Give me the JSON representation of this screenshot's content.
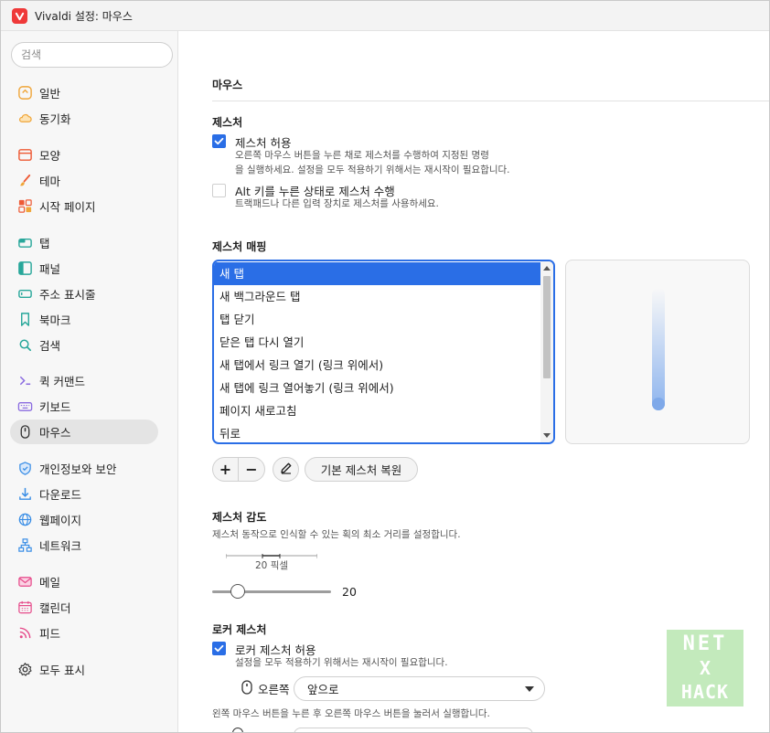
{
  "window": {
    "title": "Vivaldi 설정: 마우스"
  },
  "sidebar": {
    "search_placeholder": "검색",
    "items": [
      {
        "label": "일반",
        "icon": "general-icon",
        "color": "#f0a63a"
      },
      {
        "label": "동기화",
        "icon": "cloud-icon",
        "color": "#f0a63a"
      },
      {
        "label": "모양",
        "icon": "appearance-icon",
        "color": "#ee5a35"
      },
      {
        "label": "테마",
        "icon": "brush-icon",
        "color": "#ee5a35"
      },
      {
        "label": "시작 페이지",
        "icon": "grid-icon",
        "color": "#ee5a35"
      },
      {
        "label": "탭",
        "icon": "tab-icon",
        "color": "#28a79a"
      },
      {
        "label": "패널",
        "icon": "panel-icon",
        "color": "#28a79a"
      },
      {
        "label": "주소 표시줄",
        "icon": "address-bar-icon",
        "color": "#28a79a"
      },
      {
        "label": "북마크",
        "icon": "bookmark-icon",
        "color": "#28a79a"
      },
      {
        "label": "검색",
        "icon": "search-icon",
        "color": "#28a79a"
      },
      {
        "label": "퀵 커맨드",
        "icon": "quick-command-icon",
        "color": "#8a6be0"
      },
      {
        "label": "키보드",
        "icon": "keyboard-icon",
        "color": "#8a6be0"
      },
      {
        "label": "마우스",
        "icon": "mouse-icon",
        "color": "#333333"
      },
      {
        "label": "개인정보와 보안",
        "icon": "shield-icon",
        "color": "#3a8ee6"
      },
      {
        "label": "다운로드",
        "icon": "download-icon",
        "color": "#3a8ee6"
      },
      {
        "label": "웹페이지",
        "icon": "globe-icon",
        "color": "#3a8ee6"
      },
      {
        "label": "네트워크",
        "icon": "network-icon",
        "color": "#3a8ee6"
      },
      {
        "label": "메일",
        "icon": "mail-icon",
        "color": "#e64a8a"
      },
      {
        "label": "캘린더",
        "icon": "calendar-icon",
        "color": "#e64a8a"
      },
      {
        "label": "피드",
        "icon": "feed-icon",
        "color": "#e64a8a"
      },
      {
        "label": "모두 표시",
        "icon": "gear-icon",
        "color": "#333333"
      }
    ]
  },
  "main": {
    "page_title": "마우스",
    "gestures": {
      "title": "제스처",
      "allow_label": "제스처 허용",
      "allow_desc_1": "오른쪽 마우스 버튼을 누른 채로 제스처를 수행하여 지정된 명령",
      "allow_desc_2": "을 실행하세요. 설정을 모두 적용하기 위해서는 재시작이 필요합니다.",
      "alt_label": "Alt 키를 누른 상태로 제스처 수행",
      "alt_desc": "트랙패드나 다른 입력 장치로 제스처를 사용하세요."
    },
    "mapping": {
      "title": "제스처 매핑",
      "items": [
        "새 탭",
        "새 백그라운드 탭",
        "탭 닫기",
        "닫은 탭 다시 열기",
        "새 탭에서 링크 열기 (링크 위에서)",
        "새 탭에 링크 열어놓기 (링크 위에서)",
        "페이지 새로고침",
        "뒤로"
      ],
      "reset_label": "기본 제스처 복원",
      "add_symbol": "+",
      "remove_symbol": "−"
    },
    "sensitivity": {
      "title": "제스처 감도",
      "desc": "제스처 동작으로 인식할 수 있는 획의 최소 거리를 설정합니다.",
      "scale_label": "20 픽셀",
      "value": "20"
    },
    "rocker": {
      "title": "로커 제스처",
      "allow_label": "로커 제스처 허용",
      "allow_desc": "설정을 모두 적용하기 위해서는 재시작이 필요합니다.",
      "right_label": "오른쪽",
      "right_value": "앞으로",
      "right_desc": "왼쪽 마우스 버튼을 누른 후 오른쪽 마우스 버튼을 눌러서 실행합니다."
    }
  },
  "watermark": {
    "line1": "NET",
    "line2": "X",
    "line3": "HACK"
  },
  "colors": {
    "accent": "#2a6ee6"
  }
}
